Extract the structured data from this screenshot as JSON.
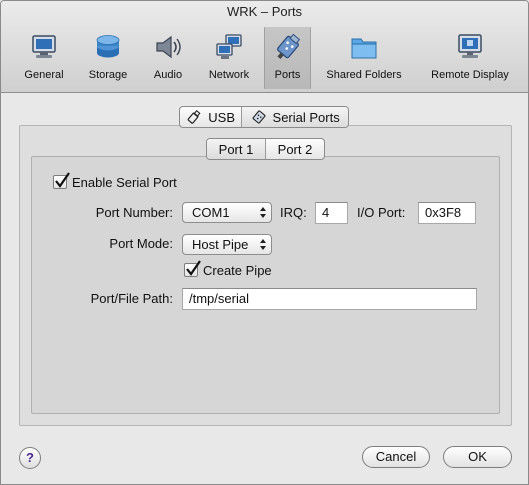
{
  "window": {
    "title": "WRK – Ports"
  },
  "toolbar": {
    "items": [
      {
        "label": "General",
        "icon": "monitor-icon"
      },
      {
        "label": "Storage",
        "icon": "disk-stack-icon"
      },
      {
        "label": "Audio",
        "icon": "speaker-icon"
      },
      {
        "label": "Network",
        "icon": "network-icon"
      },
      {
        "label": "Ports",
        "icon": "ports-icon",
        "selected": true
      },
      {
        "label": "Shared Folders",
        "icon": "folder-icon"
      },
      {
        "label": "Remote Display",
        "icon": "remote-display-icon"
      }
    ]
  },
  "main": {
    "tabs": [
      {
        "label": "USB",
        "icon": "usb-icon"
      },
      {
        "label": "Serial Ports",
        "icon": "serial-port-icon",
        "selected": true
      }
    ],
    "subtabs": [
      {
        "label": "Port 1",
        "selected": true
      },
      {
        "label": "Port 2"
      }
    ],
    "enable_serial_port": {
      "label": "Enable Serial Port",
      "checked": true
    },
    "port_number": {
      "label": "Port Number:",
      "value": "COM1"
    },
    "irq": {
      "label": "IRQ:",
      "value": "4"
    },
    "io_port": {
      "label": "I/O Port:",
      "value": "0x3F8"
    },
    "port_mode": {
      "label": "Port Mode:",
      "value": "Host Pipe"
    },
    "create_pipe": {
      "label": "Create Pipe",
      "checked": true
    },
    "port_path": {
      "label": "Port/File Path:",
      "value": "/tmp/serial"
    }
  },
  "footer": {
    "help_label": "?",
    "cancel_label": "Cancel",
    "ok_label": "OK"
  },
  "colors": {
    "window_bg": "#e8e8e8",
    "panel_bg": "#dedede",
    "help_glyph": "#4b2a8f"
  }
}
